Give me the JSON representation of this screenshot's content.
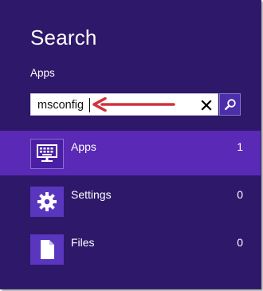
{
  "charm": {
    "title": "Search",
    "scope": "Apps"
  },
  "search": {
    "value": "msconfig",
    "placeholder": "",
    "clear_icon": "close-icon",
    "go_icon": "search-icon"
  },
  "results": [
    {
      "label": "Apps",
      "count": "1",
      "icon": "apps-keyboard-icon",
      "selected": true
    },
    {
      "label": "Settings",
      "count": "0",
      "icon": "gear-icon",
      "selected": false
    },
    {
      "label": "Files",
      "count": "0",
      "icon": "document-icon",
      "selected": false
    }
  ],
  "colors": {
    "background": "#2e1869",
    "selected_row": "#5a29b5",
    "tile": "#5a36bf",
    "annotation_arrow": "#d2323c"
  }
}
